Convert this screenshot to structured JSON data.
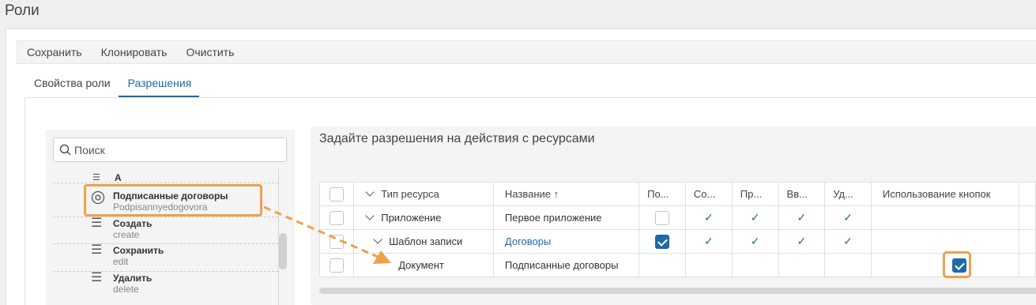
{
  "page": {
    "title": "Роли"
  },
  "toolbar": {
    "save": "Сохранить",
    "clone": "Клонировать",
    "clear": "Очистить"
  },
  "tabs": [
    {
      "label": "Свойства роли",
      "active": false
    },
    {
      "label": "Разрешения",
      "active": true
    }
  ],
  "search": {
    "placeholder": "Поиск"
  },
  "tree": {
    "items": [
      {
        "icon": "target-icon",
        "title": "Подписанные договоры",
        "subtitle": "Podpisannyedogovora"
      },
      {
        "icon": "lines-icon",
        "title": "Создать",
        "subtitle": "create"
      },
      {
        "icon": "lines-icon",
        "title": "Сохранить",
        "subtitle": "edit"
      },
      {
        "icon": "lines-icon",
        "title": "Удалить",
        "subtitle": "delete"
      }
    ],
    "partial_top_label": "A"
  },
  "permissions": {
    "title": "Задайте разрешения на действия с ресурсами",
    "columns": {
      "type": "Тип ресурса",
      "name": "Название ↑",
      "c1": "По...",
      "c2": "Со...",
      "c3": "Пр...",
      "c4": "Вв...",
      "c5": "Уд...",
      "buttons": "Использование кнопок"
    },
    "rows": [
      {
        "type": "Приложение",
        "name": "Первое приложение"
      },
      {
        "type": "Шаблон записи",
        "name": "Договоры"
      },
      {
        "type": "Документ",
        "name": "Подписанные договоры"
      }
    ]
  },
  "colors": {
    "accent": "#1f6aa5",
    "highlight": "#f0a04b"
  }
}
